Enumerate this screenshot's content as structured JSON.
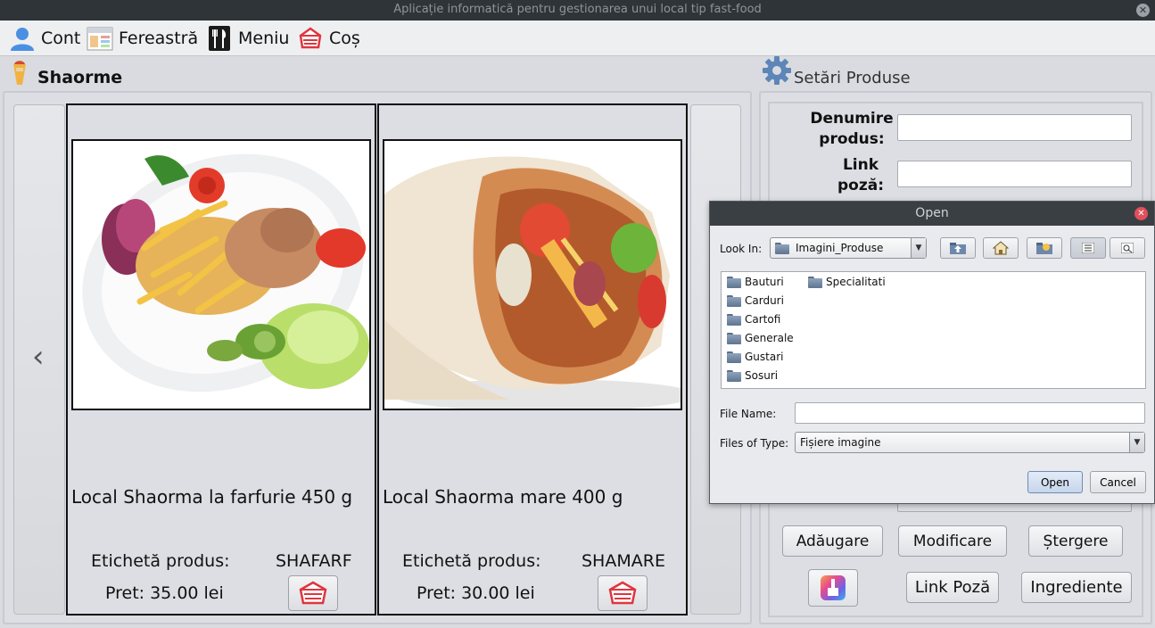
{
  "window": {
    "title": "Aplicație informatică pentru gestionarea unui local tip fast-food"
  },
  "menu": {
    "items": [
      {
        "label": "Cont",
        "icon": "user-icon"
      },
      {
        "label": "Fereastră",
        "icon": "window-icon"
      },
      {
        "label": "Meniu",
        "icon": "cutlery-icon"
      },
      {
        "label": "Coș",
        "icon": "basket-icon"
      }
    ]
  },
  "products_section": {
    "title": "Shaorme",
    "cards": [
      {
        "name": "Local Shaorma la farfurie 450 g",
        "tag_label": "Etichetă produs:",
        "tag": "SHAFARF",
        "price": "Pret: 35.00 lei",
        "image": "shawarma-plate"
      },
      {
        "name": "Local Shaorma mare 400 g",
        "tag_label": "Etichetă produs:",
        "tag": "SHAMARE",
        "price": "Pret: 30.00 lei",
        "image": "shawarma-wrap"
      }
    ],
    "prev_glyph": "‹"
  },
  "settings": {
    "title": "Setări Produse",
    "name_label_1": "Denumire",
    "name_label_2": "produs:",
    "link_label_1": "Link",
    "link_label_2": "poză:",
    "name_value": "",
    "link_value": "",
    "buttons": {
      "add": "Adăugare",
      "modify": "Modificare",
      "delete": "Ștergere",
      "link": "Link Poză",
      "ingredients": "Ingrediente"
    }
  },
  "open_dialog": {
    "title": "Open",
    "look_in_label": "Look In:",
    "look_in_value": "Imagini_Produse",
    "folders_col1": [
      "Bauturi",
      "Carduri",
      "Cartofi",
      "Generale",
      "Gustari",
      "Sosuri"
    ],
    "folders_col2": [
      "Specialitati"
    ],
    "file_name_label": "File Name:",
    "file_name_value": "",
    "files_of_type_label": "Files of Type:",
    "files_of_type_value": "Fișiere imagine",
    "open_button": "Open",
    "cancel_button": "Cancel"
  },
  "colors": {
    "accent_red": "#d6283a",
    "basket_red": "#e0353f",
    "titlebar": "#2f3438",
    "dialog_titlebar": "#3a3f44"
  }
}
